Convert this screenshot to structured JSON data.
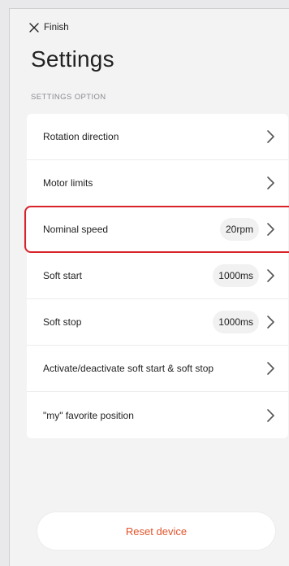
{
  "header": {
    "finish_label": "Finish",
    "title": "Settings",
    "section_label": "SETTINGS OPTION"
  },
  "settings": [
    {
      "label": "Rotation direction",
      "value": ""
    },
    {
      "label": "Motor limits",
      "value": ""
    },
    {
      "label": "Nominal speed",
      "value": "20rpm",
      "highlighted": true
    },
    {
      "label": "Soft start",
      "value": "1000ms"
    },
    {
      "label": "Soft stop",
      "value": "1000ms"
    },
    {
      "label": "Activate/deactivate soft start & soft stop",
      "value": ""
    },
    {
      "label": "\"my\" favorite position",
      "value": ""
    }
  ],
  "footer": {
    "reset_label": "Reset device"
  },
  "colors": {
    "accent": "#e1542b",
    "highlight": "#d8232a"
  },
  "icons": {
    "close": "close-icon",
    "chevron": "chevron-right-icon"
  }
}
